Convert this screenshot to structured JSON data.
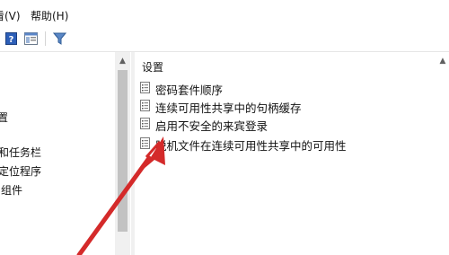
{
  "menubar": {
    "items": [
      "看(V)",
      "帮助(H)"
    ]
  },
  "toolbar": {
    "icons": [
      "help-icon",
      "show-hide-pane-icon",
      "filter-icon"
    ]
  },
  "left_pane": {
    "items": [
      "置",
      "和任务栏",
      "定位程序",
      "组件"
    ]
  },
  "right_pane": {
    "column_header": "设置",
    "policies": [
      "密码套件顺序",
      "连续可用性共享中的句柄缓存",
      "启用不安全的来宾登录",
      "脱机文件在连续可用性共享中的可用性"
    ]
  },
  "annotation": {
    "arrow_color": "#d42a2a"
  }
}
